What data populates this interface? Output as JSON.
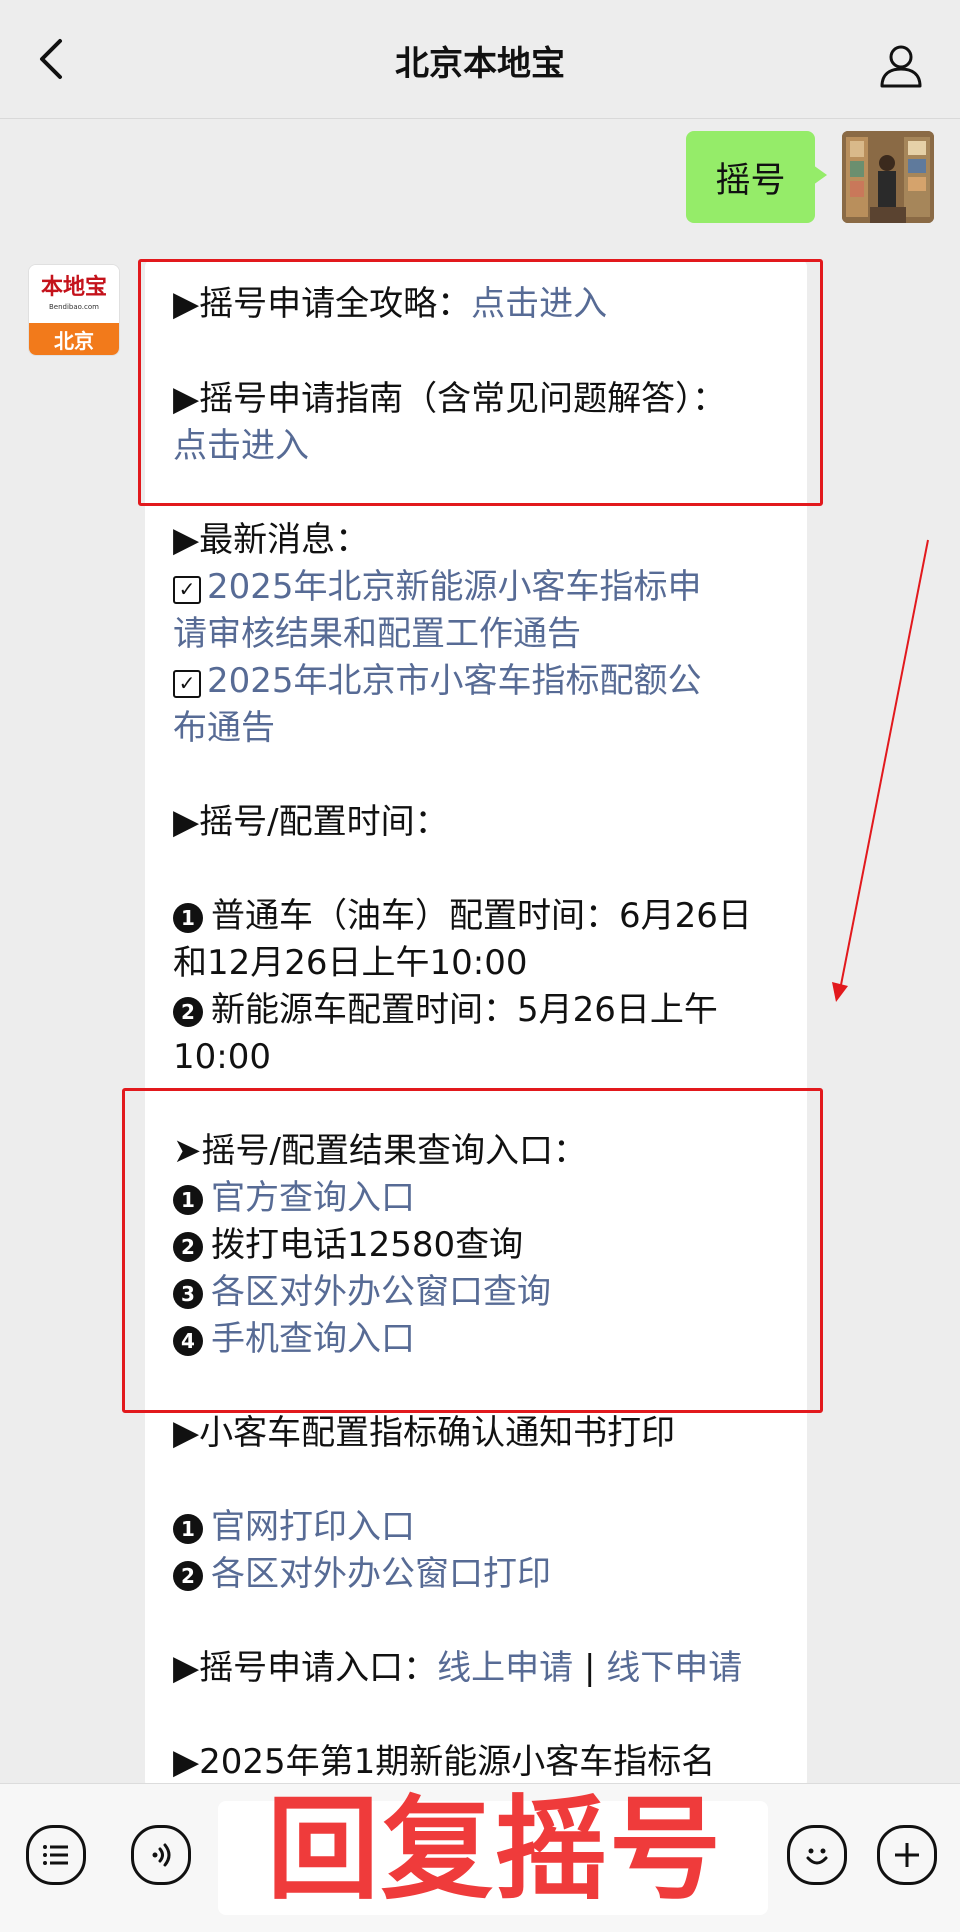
{
  "header": {
    "title": "北京本地宝"
  },
  "user_message": {
    "text": "摇号"
  },
  "bot_avatar": {
    "brand": "本地宝",
    "domain": "Bendibao.com",
    "city": "北京"
  },
  "message": {
    "l1_prefix": "▶摇号申请全攻略：",
    "l1_link": "点击进入",
    "l2_text": "▶摇号申请指南（含常见问题解答）：",
    "l2_link": "点击进入",
    "news_title": "▶最新消息：",
    "news1_line1": "2025年北京新能源小客车指标申",
    "news1_line2": "请审核结果和配置工作通告",
    "news2_line1": "2025年北京市小客车指标配额公",
    "news2_line2": "布通告",
    "time_title": "▶摇号/配置时间：",
    "time1_line1": "普通车（油车）配置时间：6月26日",
    "time1_line2": "和12月26日上午10:00",
    "time2_line1": "新能源车配置时间：5月26日上午",
    "time2_line2": "10:00",
    "query_title": "➤摇号/配置结果查询入口：",
    "query1": "官方查询入口",
    "query2": "拨打电话12580查询",
    "query3": "各区对外办公窗口查询",
    "query4": "手机查询入口",
    "print_title": "▶小客车配置指标确认通知书打印",
    "print1": "官网打印入口",
    "print2": "各区对外办公窗口打印",
    "apply_prefix": "▶摇号申请入口：",
    "apply_online": "线上申请",
    "apply_sep": " | ",
    "apply_offline": "线下申请",
    "last_line": "▶2025年第1期新能源小客车指标名"
  },
  "badges": {
    "n1": "1",
    "n2": "2",
    "n3": "3",
    "n4": "4",
    "check": "✓"
  },
  "overlay": {
    "text": "回复摇号"
  },
  "colors": {
    "link": "#576b95",
    "bubble_green": "#95ec69",
    "highlight_red": "#e2191d"
  }
}
